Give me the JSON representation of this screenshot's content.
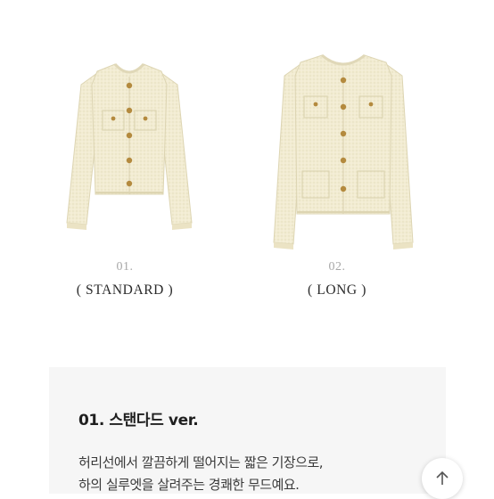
{
  "products": [
    {
      "number": "01.",
      "name": "( STANDARD )"
    },
    {
      "number": "02.",
      "name": "( LONG )"
    }
  ],
  "description": {
    "title": "01. 스탠다드 ver.",
    "lines": [
      "허리선에서 깔끔하게 떨어지는 짧은 기장으로,",
      "하의 실루엣을 살려주는 경쾌한 무드예요."
    ]
  },
  "scroll_top_button": {
    "icon": "arrow-up-icon"
  },
  "colors": {
    "jacket": "#f2ecd2",
    "button_gold": "#b48a3e",
    "card_background": "#f6f6f6"
  }
}
